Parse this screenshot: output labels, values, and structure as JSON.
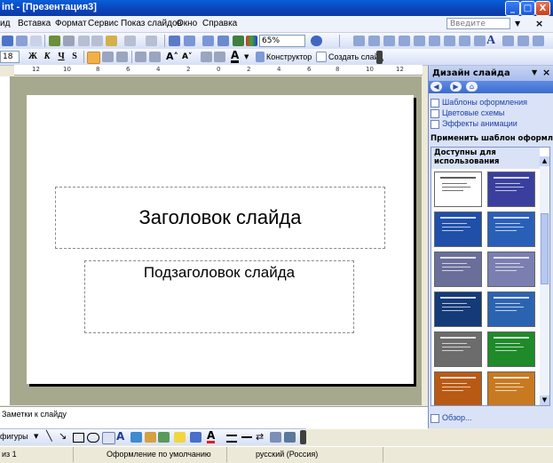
{
  "window": {
    "title": "int - [Презентация3]",
    "controls": [
      "_",
      "□",
      "X"
    ]
  },
  "menu": {
    "items": [
      "ид",
      "Вставка",
      "Формат",
      "Сервис",
      "Показ слайдов",
      "Окно",
      "Справка"
    ],
    "help_placeholder": "Введите вопрос"
  },
  "toolbar_standard": {
    "zoom": "65%"
  },
  "toolbar_formatting": {
    "font_size": "18",
    "bold": "Ж",
    "italic": "К",
    "underline": "Ч",
    "shadow": "S",
    "designer": "Конструктор",
    "new_slide": "Создать слайд"
  },
  "ruler": {
    "labels": [
      "12",
      "10",
      "8",
      "6",
      "4",
      "2",
      "0",
      "2",
      "4",
      "6",
      "8",
      "10",
      "12"
    ]
  },
  "slide": {
    "title_placeholder": "Заголовок слайда",
    "subtitle_placeholder": "Подзаголовок слайда"
  },
  "notes": {
    "placeholder": "Заметки к слайду"
  },
  "task_pane": {
    "title": "Дизайн слайда",
    "links": [
      "Шаблоны оформления",
      "Цветовые схемы",
      "Эффекты анимации"
    ],
    "apply_label": "Применить шаблон оформления:",
    "available_label": "Доступны для использования",
    "browse_link": "Обзор..."
  },
  "drawing_toolbar": {
    "autoshapes": "фигуры"
  },
  "status_bar": {
    "slide": "из 1",
    "design": "Оформление по умолчанию",
    "language": "русский (Россия)"
  },
  "colors": {
    "title_bar": "#0B43B8",
    "workspace": "#A7A98E",
    "task_pane": "#D9E2F6",
    "link": "#1F3FA8"
  },
  "templates": [
    {
      "bg": "#FFFFFF",
      "fg": "#333333"
    },
    {
      "bg": "#3A3F9E",
      "fg": "#FFFFFF"
    },
    {
      "bg": "#1F4FA8",
      "fg": "#FFFFFF"
    },
    {
      "bg": "#2A5FB8",
      "fg": "#FFFFFF"
    },
    {
      "bg": "#6A6F9A",
      "fg": "#FFFFFF"
    },
    {
      "bg": "#7A7FB0",
      "fg": "#FFFFFF"
    },
    {
      "bg": "#143A78",
      "fg": "#FFFFFF"
    },
    {
      "bg": "#2C63B0",
      "fg": "#FFFFFF"
    },
    {
      "bg": "#6C6C6C",
      "fg": "#FFFFFF"
    },
    {
      "bg": "#1E8A2A",
      "fg": "#FFFFFF"
    },
    {
      "bg": "#B85A14",
      "fg": "#FFFFFF"
    },
    {
      "bg": "#C77A20",
      "fg": "#FFFFFF"
    }
  ]
}
